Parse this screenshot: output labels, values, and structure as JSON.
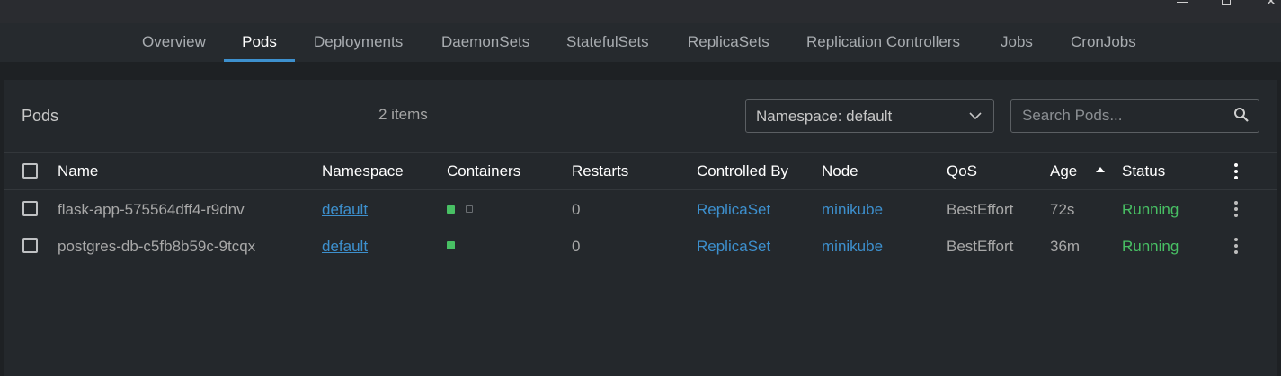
{
  "window": {
    "controls": [
      "minimize",
      "maximize",
      "close"
    ]
  },
  "tabs": [
    {
      "label": "Overview",
      "active": false
    },
    {
      "label": "Pods",
      "active": true
    },
    {
      "label": "Deployments",
      "active": false
    },
    {
      "label": "DaemonSets",
      "active": false
    },
    {
      "label": "StatefulSets",
      "active": false
    },
    {
      "label": "ReplicaSets",
      "active": false
    },
    {
      "label": "Replication Controllers",
      "active": false
    },
    {
      "label": "Jobs",
      "active": false
    },
    {
      "label": "CronJobs",
      "active": false
    }
  ],
  "header": {
    "title": "Pods",
    "count": "2 items",
    "namespace_select": "Namespace: default",
    "search_placeholder": "Search Pods..."
  },
  "table": {
    "columns": [
      "Name",
      "Namespace",
      "Containers",
      "Restarts",
      "Controlled By",
      "Node",
      "QoS",
      "Age",
      "Status"
    ],
    "sort": {
      "column": "Age",
      "direction": "ascending"
    },
    "rows": [
      {
        "name": "flask-app-575564dff4-r9dnv",
        "namespace": "default",
        "containers": [
          "running",
          "empty"
        ],
        "restarts": "0",
        "controlled_by": "ReplicaSet",
        "node": "minikube",
        "qos": "BestEffort",
        "age": "72s",
        "status": "Running"
      },
      {
        "name": "postgres-db-c5fb8b59c-9tcqx",
        "namespace": "default",
        "containers": [
          "running"
        ],
        "restarts": "0",
        "controlled_by": "ReplicaSet",
        "node": "minikube",
        "qos": "BestEffort",
        "age": "36m",
        "status": "Running"
      }
    ]
  },
  "colors": {
    "accent": "#3d90ce",
    "running": "#48c064",
    "background": "#24282c"
  }
}
